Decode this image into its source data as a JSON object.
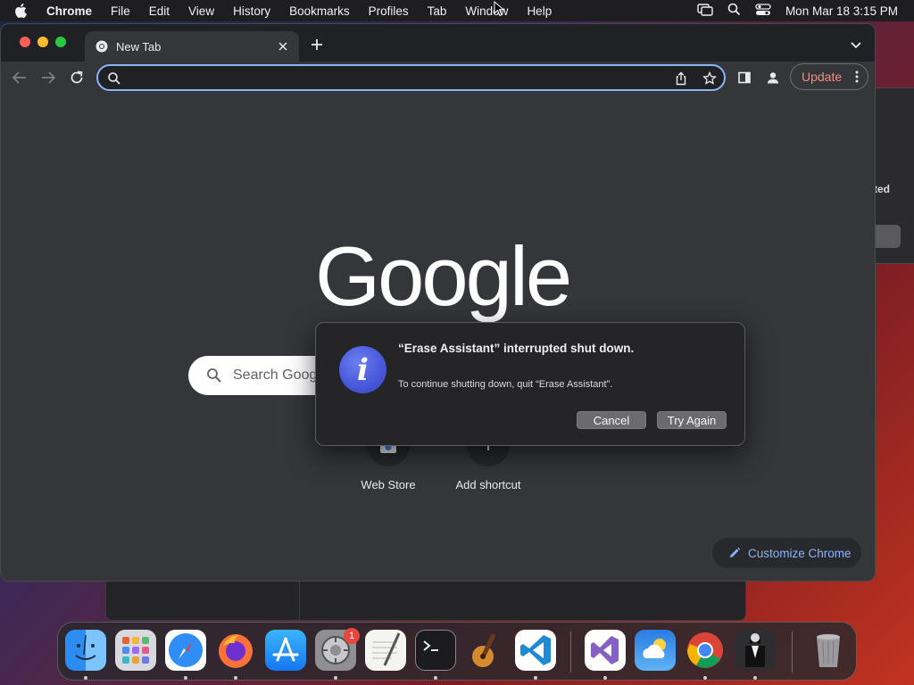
{
  "menubar": {
    "app_name": "Chrome",
    "items": [
      "File",
      "Edit",
      "View",
      "History",
      "Bookmarks",
      "Profiles",
      "Tab",
      "Window",
      "Help"
    ],
    "clock": "Mon Mar 18  3:15 PM",
    "status_icons": [
      "screen-mirror-icon",
      "spotlight-search-icon",
      "control-center-icon"
    ]
  },
  "browser": {
    "tab": {
      "title": "New Tab",
      "favicon": "chrome-icon"
    },
    "omnibox": {
      "value": "",
      "placeholder": ""
    },
    "update_button": "Update"
  },
  "ntp": {
    "logo_text": "Google",
    "search_placeholder": "Search Google or type a URL",
    "shortcuts": [
      {
        "label": "Web Store",
        "icon": "web-store-icon"
      },
      {
        "label": "Add shortcut",
        "icon": "plus-icon"
      }
    ],
    "customize_label": "Customize Chrome"
  },
  "alert": {
    "title": "“Erase Assistant” interrupted shut down.",
    "message": "To continue shutting down, quit “Erase Assistant”.",
    "cancel_label": "Cancel",
    "retry_label": "Try Again",
    "icon": "info-icon"
  },
  "background_window": {
    "text": "ted"
  },
  "dock": {
    "apps": [
      "finder-icon",
      "launchpad-icon",
      "safari-icon",
      "firefox-icon",
      "app-store-icon",
      "system-settings-icon",
      "textedit-icon",
      "terminal-icon",
      "garageband-icon",
      "vscode-icon",
      "visual-studio-icon",
      "weather-icon",
      "chrome-icon",
      "bartender-icon",
      "trash-icon"
    ],
    "settings_badge": "1"
  }
}
